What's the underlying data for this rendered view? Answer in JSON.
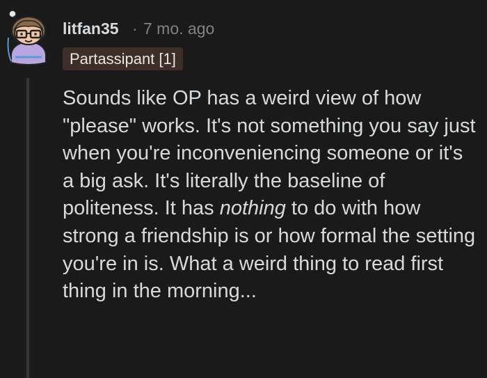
{
  "comment": {
    "username": "litfan35",
    "separator": "·",
    "timestamp": "7 mo. ago",
    "flair": "Partassipant [1]",
    "body_before_italic": "Sounds like OP has a weird view of how \"please\" works. It's not something you say just when you're inconveniencing someone or it's a big ask. It's literally the baseline of politeness. It has ",
    "body_italic": "nothing",
    "body_after_italic": " to do with how strong a friendship is or how formal the setting you're in is. What a weird thing to read first thing in the morning..."
  },
  "avatar": {
    "icon": "snoo-avatar-with-glasses-icon",
    "skin_color": "#f2c7a5",
    "hair_color": "#8a6a4a",
    "shirt_color": "#b9a6e0",
    "outline_color": "#5b9bd5"
  },
  "colors": {
    "background": "#1a1a1b",
    "text": "#d7dadc",
    "muted": "#818384",
    "flair_bg": "#3d2e27",
    "thread_line": "#343536"
  }
}
